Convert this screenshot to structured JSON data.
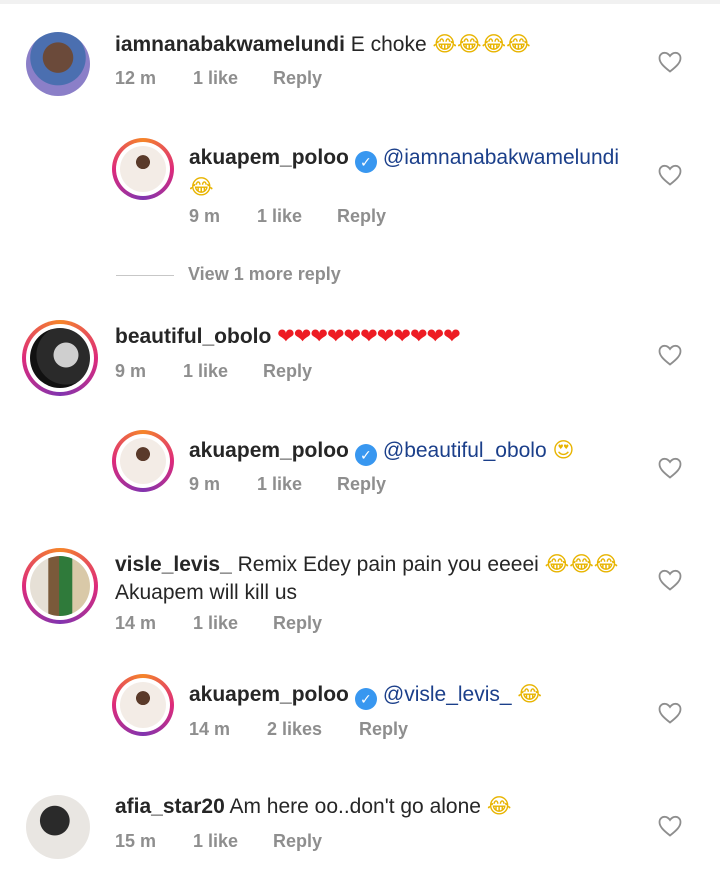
{
  "comments": [
    {
      "username": "iamnanabakwamelundi",
      "text": "E choke",
      "emoji": "😂😂😂😂",
      "time": "12 m",
      "likes": "1 like",
      "reply": "Reply"
    },
    {
      "username": "akuapem_poloo",
      "mention": "@iamnanabakwamelundi",
      "emoji": "😂",
      "time": "9 m",
      "likes": "1 like",
      "reply": "Reply"
    },
    {
      "username": "beautiful_obolo",
      "emoji": "❤❤❤❤❤❤❤❤❤❤❤",
      "time": "9 m",
      "likes": "1 like",
      "reply": "Reply"
    },
    {
      "username": "akuapem_poloo",
      "mention": "@beautiful_obolo",
      "emoji": "😍",
      "time": "9 m",
      "likes": "1 like",
      "reply": "Reply"
    },
    {
      "username": "visle_levis_",
      "text": "Remix Edey pain pain you eeeei",
      "emoji": "😂😂😂",
      "text2": "Akuapem will kill us",
      "time": "14 m",
      "likes": "1 like",
      "reply": "Reply"
    },
    {
      "username": "akuapem_poloo",
      "mention": "@visle_levis_",
      "emoji": "😂",
      "time": "14 m",
      "likes": "2 likes",
      "reply": "Reply"
    },
    {
      "username": "afia_star20",
      "text": "Am here oo..don't go alone",
      "emoji": "😂",
      "time": "15 m",
      "likes": "1 like",
      "reply": "Reply"
    }
  ],
  "view_more": "View 1 more reply",
  "icons": {
    "like": "heart-outline-icon",
    "verified": "verified-badge-icon"
  },
  "colors": {
    "mention": "#1b3f8a",
    "meta": "#8e8e8e",
    "verified": "#3897f0",
    "heart_emoji": "#ed1c24"
  }
}
